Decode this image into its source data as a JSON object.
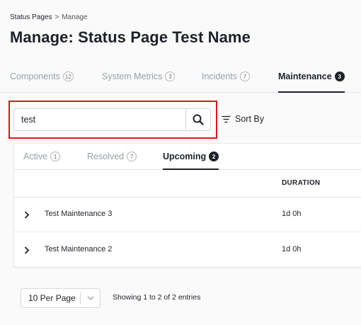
{
  "breadcrumb": {
    "root": "Status Pages",
    "separator": ">",
    "current": "Manage"
  },
  "page": {
    "title": "Manage: Status Page Test Name"
  },
  "main_tabs": [
    {
      "label": "Components",
      "count": "12"
    },
    {
      "label": "System Metrics",
      "count": "3"
    },
    {
      "label": "Incidents",
      "count": "7"
    },
    {
      "label": "Maintenance",
      "count": "3",
      "active": true
    }
  ],
  "search": {
    "value": "test",
    "icon": "search-icon"
  },
  "sort": {
    "label": "Sort By",
    "icon": "sort-lines-icon"
  },
  "sub_tabs": [
    {
      "label": "Active",
      "count": "1"
    },
    {
      "label": "Resolved",
      "count": "7"
    },
    {
      "label": "Upcoming",
      "count": "2",
      "active": true
    }
  ],
  "table": {
    "columns": [
      "",
      "DURATION"
    ],
    "rows": [
      {
        "name": "Test Maintenance 3",
        "duration": "1d 0h"
      },
      {
        "name": "Test Maintenance 2",
        "duration": "1d 0h"
      }
    ]
  },
  "pagination": {
    "per_page": "10 Per Page",
    "showing": "Showing 1 to 2 of 2 entries"
  },
  "colors": {
    "accent": "#1e2129",
    "highlight": "#e0161c",
    "muted": "#9aa0a6",
    "background": "#fafafa"
  }
}
